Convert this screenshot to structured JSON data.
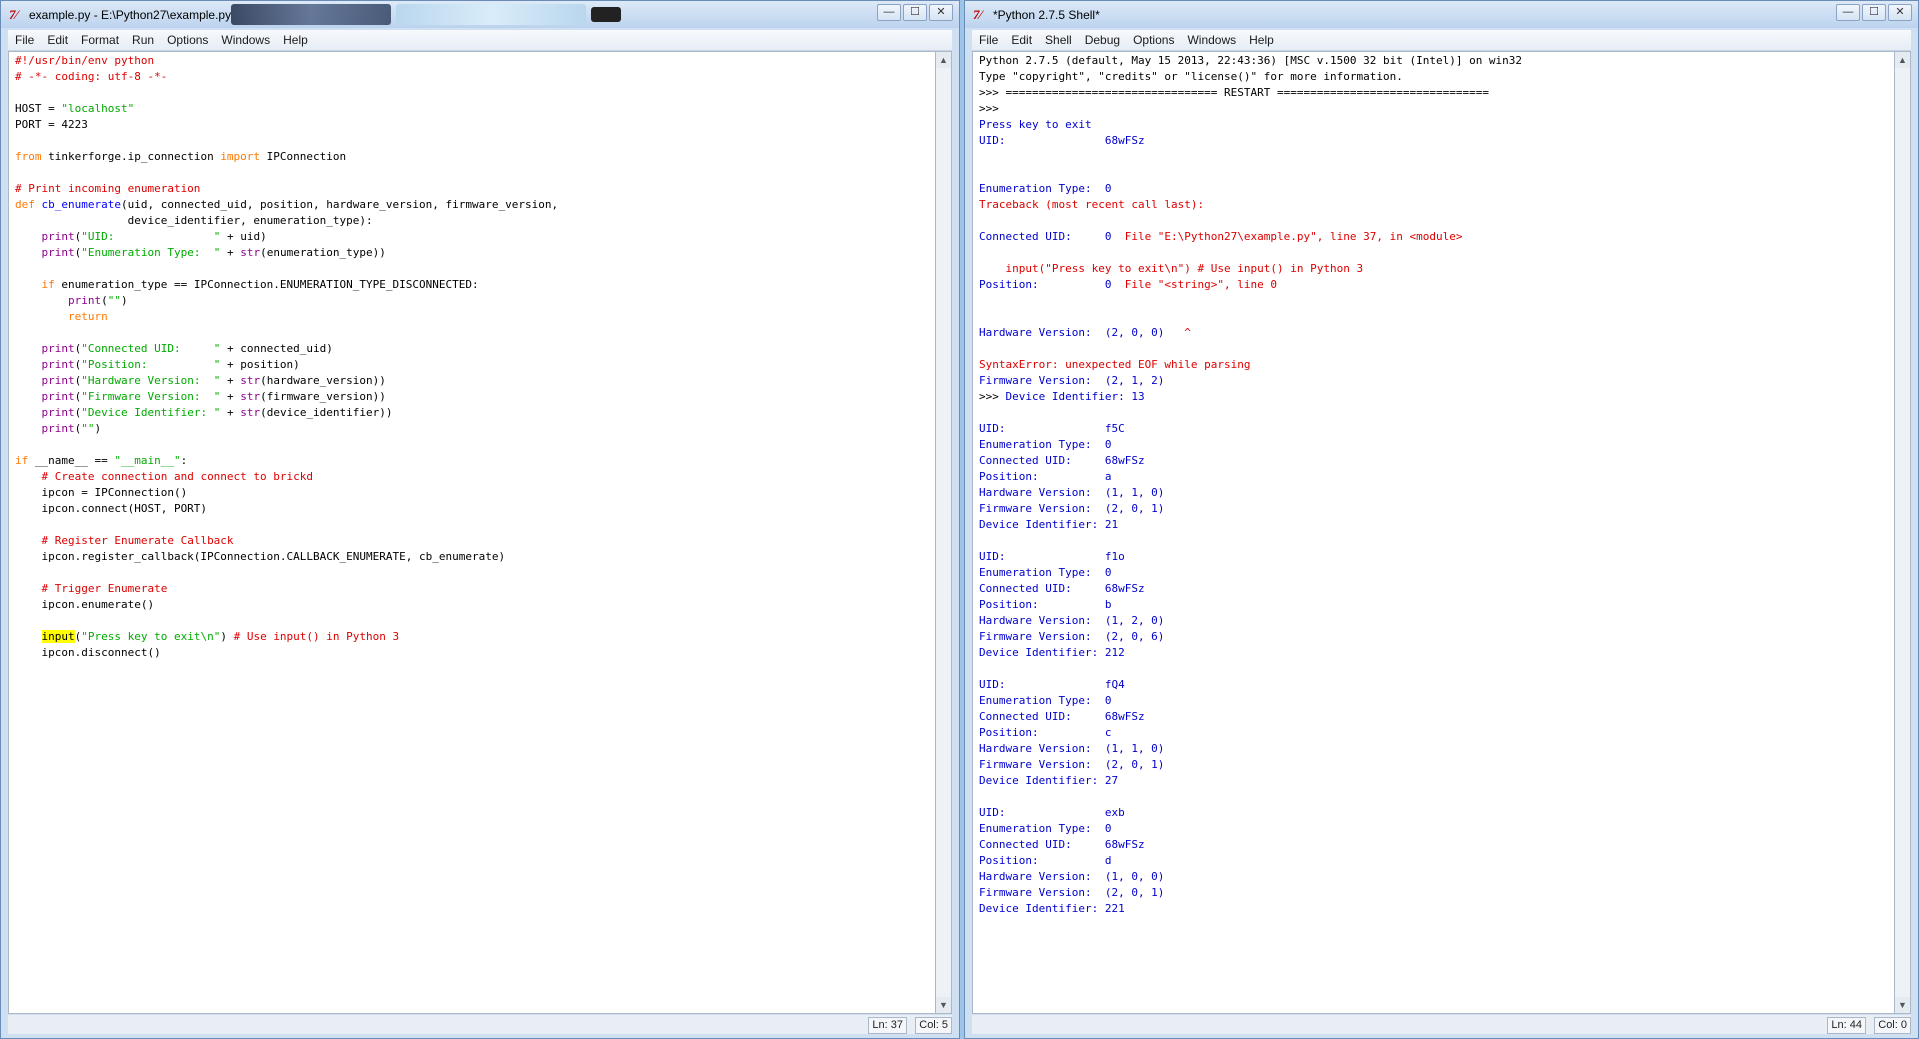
{
  "left_window": {
    "title": "example.py - E:\\Python27\\example.py",
    "menu": [
      "File",
      "Edit",
      "Format",
      "Run",
      "Options",
      "Windows",
      "Help"
    ],
    "status": {
      "ln": "Ln: 37",
      "col": "Col: 5"
    },
    "code_lines": [
      [
        {
          "t": "#!/usr/bin/env python",
          "c": "cm"
        }
      ],
      [
        {
          "t": "# -*- coding: utf-8 -*-",
          "c": "cm"
        }
      ],
      [],
      [
        {
          "t": "HOST = "
        },
        {
          "t": "\"localhost\"",
          "c": "str"
        }
      ],
      [
        {
          "t": "PORT = 4223"
        }
      ],
      [],
      [
        {
          "t": "from",
          "c": "kw"
        },
        {
          "t": " tinkerforge.ip_connection "
        },
        {
          "t": "import",
          "c": "kw"
        },
        {
          "t": " IPConnection"
        }
      ],
      [],
      [
        {
          "t": "# Print incoming enumeration",
          "c": "cm"
        }
      ],
      [
        {
          "t": "def",
          "c": "kw"
        },
        {
          "t": " "
        },
        {
          "t": "cb_enumerate",
          "c": "df"
        },
        {
          "t": "(uid, connected_uid, position, hardware_version, firmware_version,"
        }
      ],
      [
        {
          "t": "                 device_identifier, enumeration_type):"
        }
      ],
      [
        {
          "t": "    "
        },
        {
          "t": "print",
          "c": "bi"
        },
        {
          "t": "("
        },
        {
          "t": "\"UID:               \"",
          "c": "str"
        },
        {
          "t": " + uid)"
        }
      ],
      [
        {
          "t": "    "
        },
        {
          "t": "print",
          "c": "bi"
        },
        {
          "t": "("
        },
        {
          "t": "\"Enumeration Type:  \"",
          "c": "str"
        },
        {
          "t": " + "
        },
        {
          "t": "str",
          "c": "bi"
        },
        {
          "t": "(enumeration_type))"
        }
      ],
      [],
      [
        {
          "t": "    "
        },
        {
          "t": "if",
          "c": "kw"
        },
        {
          "t": " enumeration_type == IPConnection.ENUMERATION_TYPE_DISCONNECTED:"
        }
      ],
      [
        {
          "t": "        "
        },
        {
          "t": "print",
          "c": "bi"
        },
        {
          "t": "("
        },
        {
          "t": "\"\"",
          "c": "str"
        },
        {
          "t": ")"
        }
      ],
      [
        {
          "t": "        "
        },
        {
          "t": "return",
          "c": "kw"
        }
      ],
      [],
      [
        {
          "t": "    "
        },
        {
          "t": "print",
          "c": "bi"
        },
        {
          "t": "("
        },
        {
          "t": "\"Connected UID:     \"",
          "c": "str"
        },
        {
          "t": " + connected_uid)"
        }
      ],
      [
        {
          "t": "    "
        },
        {
          "t": "print",
          "c": "bi"
        },
        {
          "t": "("
        },
        {
          "t": "\"Position:          \"",
          "c": "str"
        },
        {
          "t": " + position)"
        }
      ],
      [
        {
          "t": "    "
        },
        {
          "t": "print",
          "c": "bi"
        },
        {
          "t": "("
        },
        {
          "t": "\"Hardware Version:  \"",
          "c": "str"
        },
        {
          "t": " + "
        },
        {
          "t": "str",
          "c": "bi"
        },
        {
          "t": "(hardware_version))"
        }
      ],
      [
        {
          "t": "    "
        },
        {
          "t": "print",
          "c": "bi"
        },
        {
          "t": "("
        },
        {
          "t": "\"Firmware Version:  \"",
          "c": "str"
        },
        {
          "t": " + "
        },
        {
          "t": "str",
          "c": "bi"
        },
        {
          "t": "(firmware_version))"
        }
      ],
      [
        {
          "t": "    "
        },
        {
          "t": "print",
          "c": "bi"
        },
        {
          "t": "("
        },
        {
          "t": "\"Device Identifier: \"",
          "c": "str"
        },
        {
          "t": " + "
        },
        {
          "t": "str",
          "c": "bi"
        },
        {
          "t": "(device_identifier))"
        }
      ],
      [
        {
          "t": "    "
        },
        {
          "t": "print",
          "c": "bi"
        },
        {
          "t": "("
        },
        {
          "t": "\"\"",
          "c": "str"
        },
        {
          "t": ")"
        }
      ],
      [],
      [
        {
          "t": "if",
          "c": "kw"
        },
        {
          "t": " __name__ == "
        },
        {
          "t": "\"__main__\"",
          "c": "str"
        },
        {
          "t": ":"
        }
      ],
      [
        {
          "t": "    "
        },
        {
          "t": "# Create connection and connect to brickd",
          "c": "cm"
        }
      ],
      [
        {
          "t": "    ipcon = IPConnection()"
        }
      ],
      [
        {
          "t": "    ipcon.connect(HOST, PORT)"
        }
      ],
      [],
      [
        {
          "t": "    "
        },
        {
          "t": "# Register Enumerate Callback",
          "c": "cm"
        }
      ],
      [
        {
          "t": "    ipcon.register_callback(IPConnection.CALLBACK_ENUMERATE, cb_enumerate)"
        }
      ],
      [],
      [
        {
          "t": "    "
        },
        {
          "t": "# Trigger Enumerate",
          "c": "cm"
        }
      ],
      [
        {
          "t": "    ipcon.enumerate()"
        }
      ],
      [],
      [
        {
          "t": "    "
        },
        {
          "t": "input",
          "c": "hl"
        },
        {
          "t": "("
        },
        {
          "t": "\"Press key to exit\\n\"",
          "c": "str"
        },
        {
          "t": ") "
        },
        {
          "t": "# Use input() in Python 3",
          "c": "cm"
        }
      ],
      [
        {
          "t": "    ipcon.disconnect()"
        }
      ]
    ]
  },
  "right_window": {
    "title": "*Python 2.7.5 Shell*",
    "menu": [
      "File",
      "Edit",
      "Shell",
      "Debug",
      "Options",
      "Windows",
      "Help"
    ],
    "status": {
      "ln": "Ln: 44",
      "col": "Col: 0"
    },
    "shell_lines": [
      [
        {
          "t": "Python 2.7.5 (default, May 15 2013, 22:43:36) [MSC v.1500 32 bit (Intel)] on win32",
          "c": "std"
        }
      ],
      [
        {
          "t": "Type \"copyright\", \"credits\" or \"license()\" for more information.",
          "c": "std"
        }
      ],
      [
        {
          "t": ">>> ================================ RESTART ================================",
          "c": "std"
        }
      ],
      [
        {
          "t": ">>> ",
          "c": "std"
        }
      ],
      [
        {
          "t": "Press key to exit",
          "c": "out"
        }
      ],
      [
        {
          "t": "UID:               68wFSz",
          "c": "out"
        }
      ],
      [],
      [],
      [
        {
          "t": "Enumeration Type:  0",
          "c": "out"
        }
      ],
      [
        {
          "t": "Traceback (most recent call last):",
          "c": "err"
        }
      ],
      [],
      [
        {
          "t": "Connected UID:     0",
          "c": "out"
        },
        {
          "t": "  File \"E:\\Python27\\example.py\", line 37, in <module>",
          "c": "err"
        }
      ],
      [],
      [
        {
          "t": "    input(\"Press key to exit\\n\") # Use input() in Python 3",
          "c": "err"
        }
      ],
      [
        {
          "t": "Position:          0",
          "c": "out"
        },
        {
          "t": "  File \"<string>\", line 0",
          "c": "err"
        }
      ],
      [],
      [],
      [
        {
          "t": "Hardware Version:  (2, 0, 0)",
          "c": "out"
        },
        {
          "t": "   ^",
          "c": "err"
        }
      ],
      [],
      [
        {
          "t": "SyntaxError: unexpected EOF while parsing",
          "c": "err"
        }
      ],
      [
        {
          "t": "Firmware Version:  (2, 1, 2)",
          "c": "out"
        }
      ],
      [
        {
          "t": ">>> ",
          "c": "std"
        },
        {
          "t": "Device Identifier: 13",
          "c": "out"
        }
      ],
      [],
      [
        {
          "t": "UID:               f5C",
          "c": "out"
        }
      ],
      [
        {
          "t": "Enumeration Type:  0",
          "c": "out"
        }
      ],
      [
        {
          "t": "Connected UID:     68wFSz",
          "c": "out"
        }
      ],
      [
        {
          "t": "Position:          a",
          "c": "out"
        }
      ],
      [
        {
          "t": "Hardware Version:  (1, 1, 0)",
          "c": "out"
        }
      ],
      [
        {
          "t": "Firmware Version:  (2, 0, 1)",
          "c": "out"
        }
      ],
      [
        {
          "t": "Device Identifier: 21",
          "c": "out"
        }
      ],
      [],
      [
        {
          "t": "UID:               f1o",
          "c": "out"
        }
      ],
      [
        {
          "t": "Enumeration Type:  0",
          "c": "out"
        }
      ],
      [
        {
          "t": "Connected UID:     68wFSz",
          "c": "out"
        }
      ],
      [
        {
          "t": "Position:          b",
          "c": "out"
        }
      ],
      [
        {
          "t": "Hardware Version:  (1, 2, 0)",
          "c": "out"
        }
      ],
      [
        {
          "t": "Firmware Version:  (2, 0, 6)",
          "c": "out"
        }
      ],
      [
        {
          "t": "Device Identifier: 212",
          "c": "out"
        }
      ],
      [],
      [
        {
          "t": "UID:               fQ4",
          "c": "out"
        }
      ],
      [
        {
          "t": "Enumeration Type:  0",
          "c": "out"
        }
      ],
      [
        {
          "t": "Connected UID:     68wFSz",
          "c": "out"
        }
      ],
      [
        {
          "t": "Position:          c",
          "c": "out"
        }
      ],
      [
        {
          "t": "Hardware Version:  (1, 1, 0)",
          "c": "out"
        }
      ],
      [
        {
          "t": "Firmware Version:  (2, 0, 1)",
          "c": "out"
        }
      ],
      [
        {
          "t": "Device Identifier: 27",
          "c": "out"
        }
      ],
      [],
      [
        {
          "t": "UID:               exb",
          "c": "out"
        }
      ],
      [
        {
          "t": "Enumeration Type:  0",
          "c": "out"
        }
      ],
      [
        {
          "t": "Connected UID:     68wFSz",
          "c": "out"
        }
      ],
      [
        {
          "t": "Position:          d",
          "c": "out"
        }
      ],
      [
        {
          "t": "Hardware Version:  (1, 0, 0)",
          "c": "out"
        }
      ],
      [
        {
          "t": "Firmware Version:  (2, 0, 1)",
          "c": "out"
        }
      ],
      [
        {
          "t": "Device Identifier: 221",
          "c": "out"
        }
      ]
    ]
  },
  "window_controls": {
    "minimize": "—",
    "maximize": "☐",
    "close": "✕"
  },
  "app_icon": "idle-python-icon",
  "colors": {
    "keyword": "#ff7700",
    "string": "#00aa00",
    "comment": "#dd0000",
    "builtin": "#900090",
    "definition": "#0000ff",
    "stdout": "#0000cc",
    "stderr": "#dd0000",
    "highlight": "#ffff00"
  }
}
